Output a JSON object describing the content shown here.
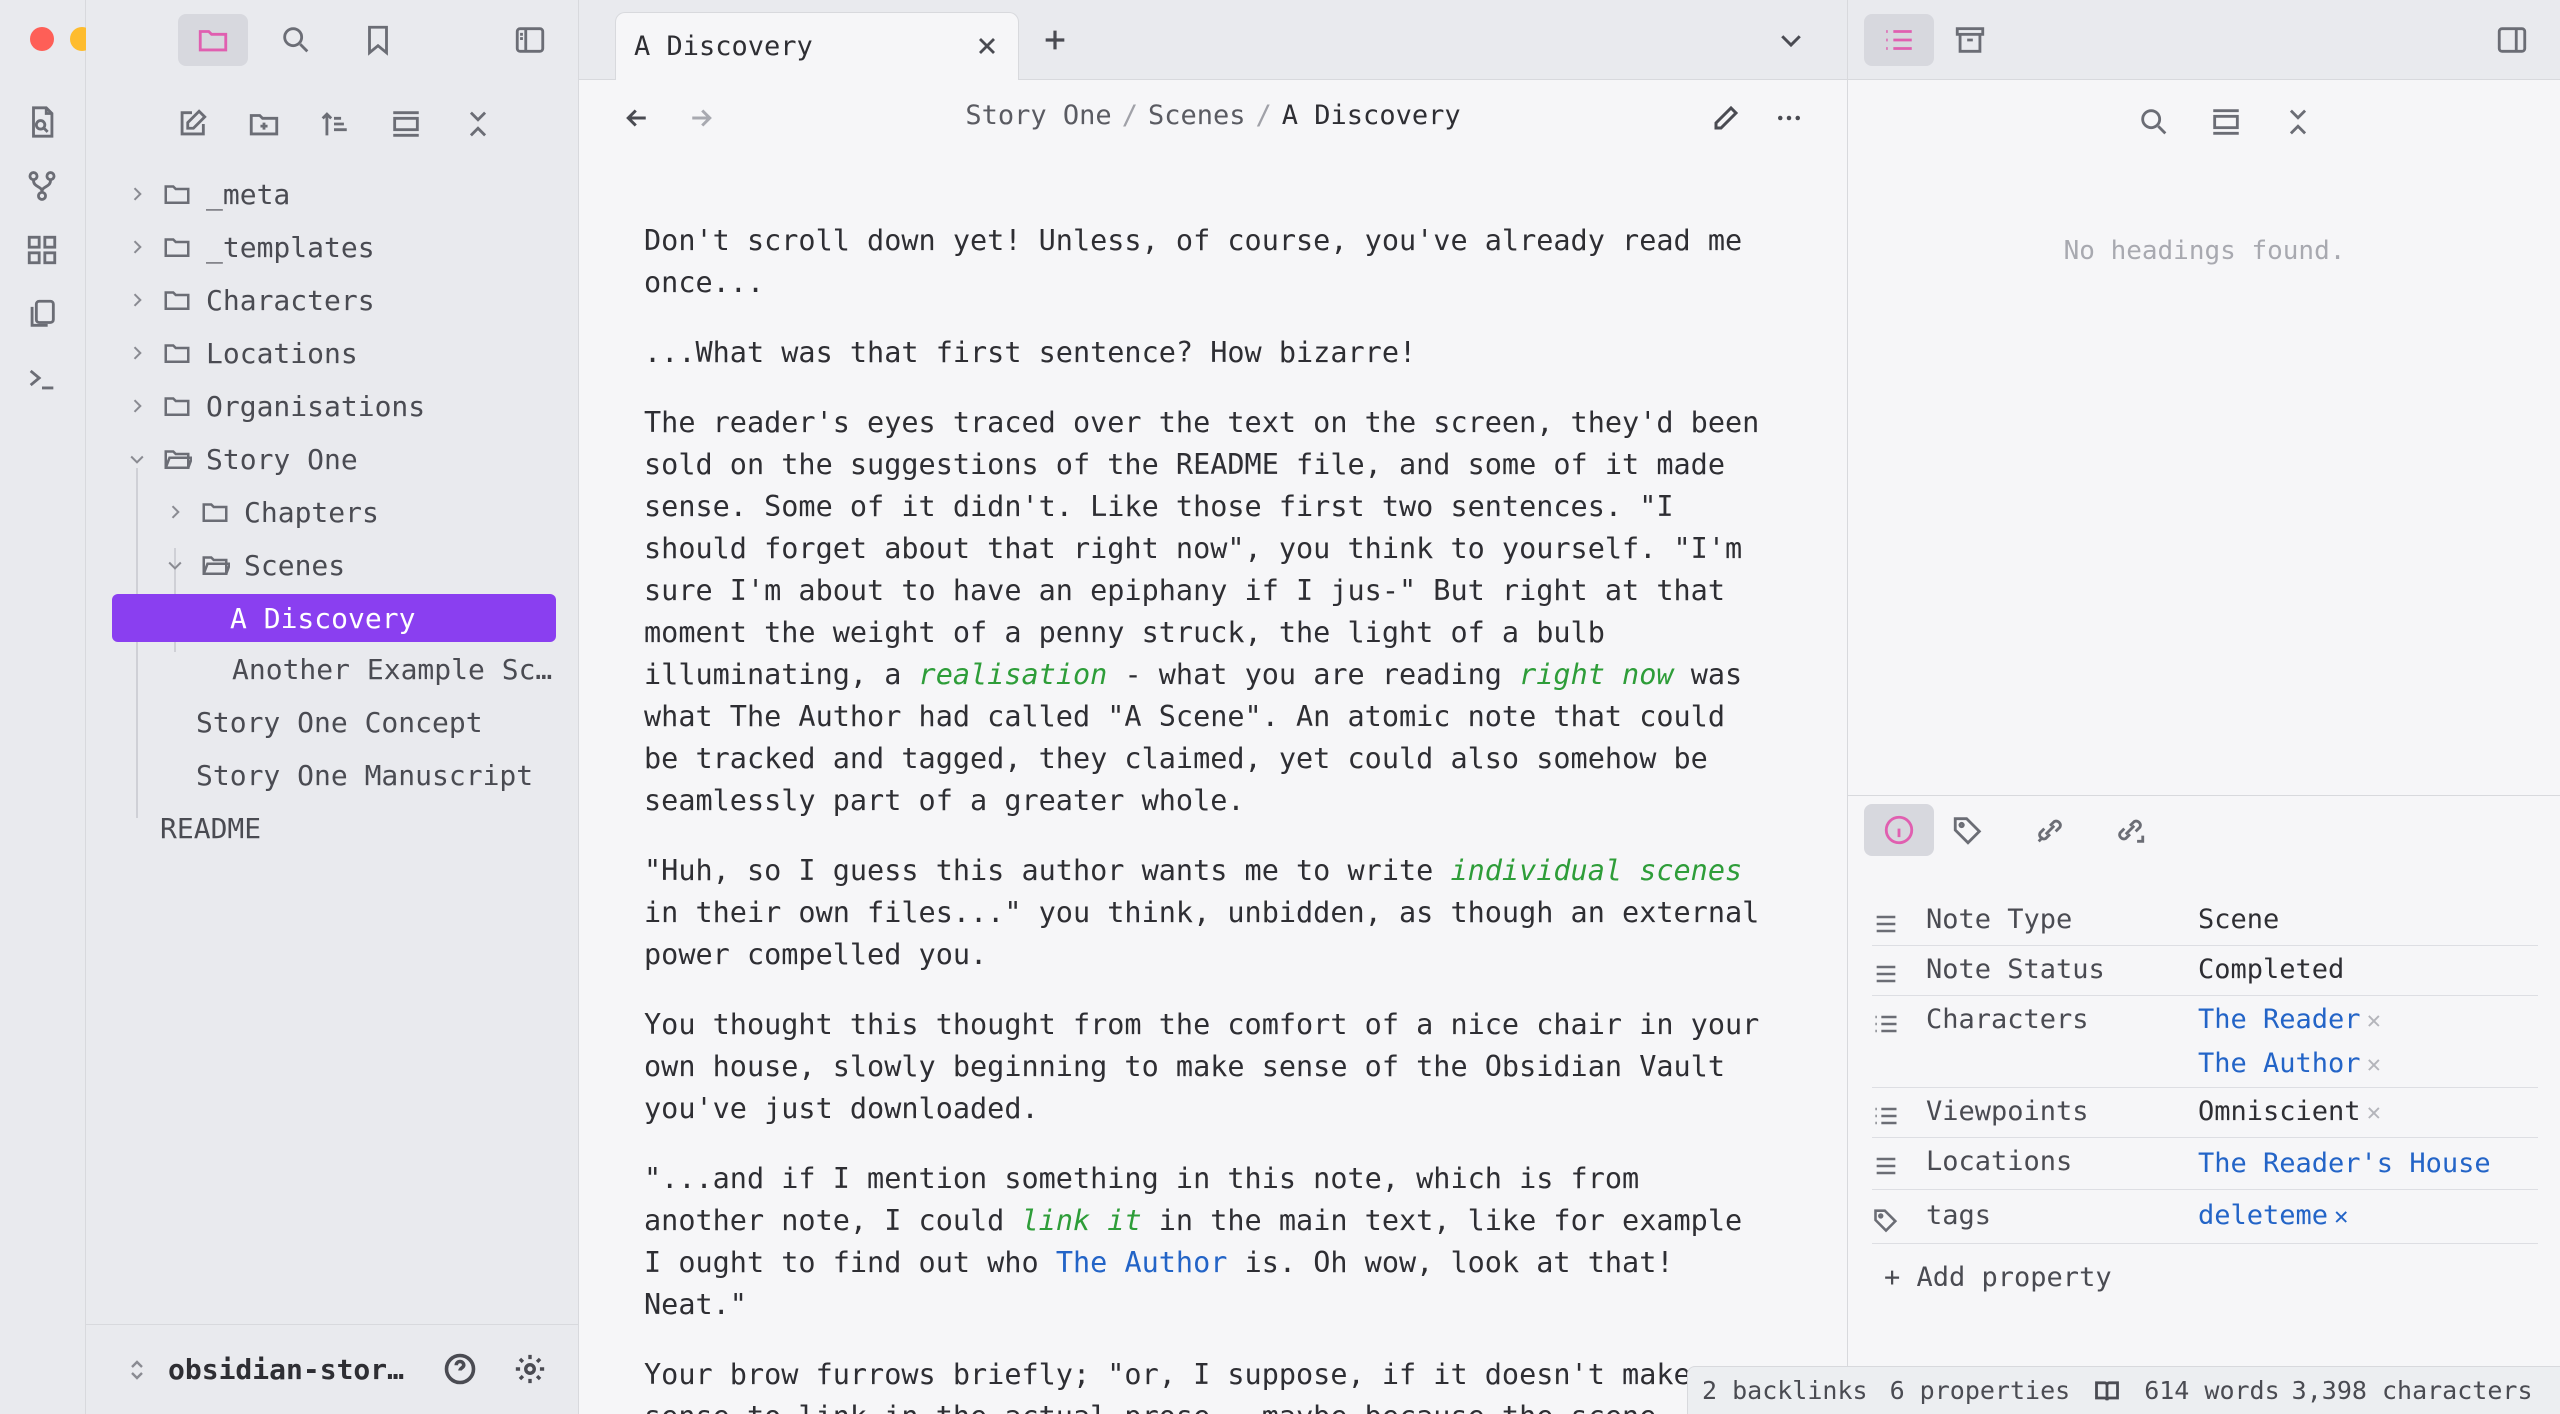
{
  "tab": {
    "title": "A Discovery"
  },
  "breadcrumb": {
    "part1": "Story One",
    "part2": "Scenes",
    "current": "A Discovery",
    "sep": "/"
  },
  "tree": {
    "items": [
      "_meta",
      "_templates",
      "Characters",
      "Locations",
      "Organisations",
      "Story One",
      "Chapters",
      "Scenes",
      "A Discovery",
      "Another Example Sc…",
      "Story One Concept",
      "Story One Manuscript",
      "README"
    ]
  },
  "vault": {
    "name": "obsidian-stor…"
  },
  "content": {
    "p1": "Don't scroll down yet! Unless, of course, you've already read me once...",
    "p2": "...What was that first sentence? How bizarre!",
    "p3a": "The reader's eyes traced over the text on the screen, they'd been sold on the suggestions of the README file, and some of it made sense. Some of it didn't. Like those first two sentences. \"I should forget about that right now\", you think to yourself. \"I'm sure I'm about to have an epiphany if I jus-\" But right at that moment the weight of a penny struck, the light of a bulb illuminating, a ",
    "p3em1": "realisation",
    "p3b": " - what you are reading ",
    "p3em2": "right now",
    "p3c": " was what The Author had called \"A Scene\". An atomic note that could be tracked and tagged, they claimed, yet could also somehow be seamlessly part of a greater whole.",
    "p4a": "\"Huh, so I guess this author wants me to write ",
    "p4em": "individual scenes",
    "p4b": " in their own files...\" you think, unbidden, as though an external power compelled you.",
    "p5": "You thought this thought from the comfort of a nice chair in your own house, slowly beginning to make sense of the Obsidian Vault you've just downloaded.",
    "p6a": "\"...and if I mention something in this note, which is from another note, I could ",
    "p6em": "link it",
    "p6b": " in the main text, like for example I ought to find out who ",
    "p6link": "The Author",
    "p6c": " is. Oh wow, look at that! Neat.\"",
    "p7": "Your brow furrows briefly; \"or, I suppose, if it doesn't make sense to link in the actual prose - maybe because the scene"
  },
  "outline": {
    "empty": "No headings found."
  },
  "properties": {
    "note_type": {
      "key": "Note Type",
      "value": "Scene"
    },
    "note_status": {
      "key": "Note Status",
      "value": "Completed"
    },
    "characters": {
      "key": "Characters",
      "v1": "The Reader",
      "v2": "The Author"
    },
    "viewpoints": {
      "key": "Viewpoints",
      "value": "Omniscient"
    },
    "locations": {
      "key": "Locations",
      "value": "The Reader's House"
    },
    "tags": {
      "key": "tags",
      "value": "deleteme"
    },
    "add": "+ Add property"
  },
  "status": {
    "backlinks": "2 backlinks",
    "properties": "6 properties",
    "words": "614 words",
    "chars": "3,398 characters"
  },
  "colors": {
    "accent": "#8a3ff0",
    "link": "#2364c7",
    "emphasis": "#2e9d39",
    "pink": "#e05fb0"
  }
}
